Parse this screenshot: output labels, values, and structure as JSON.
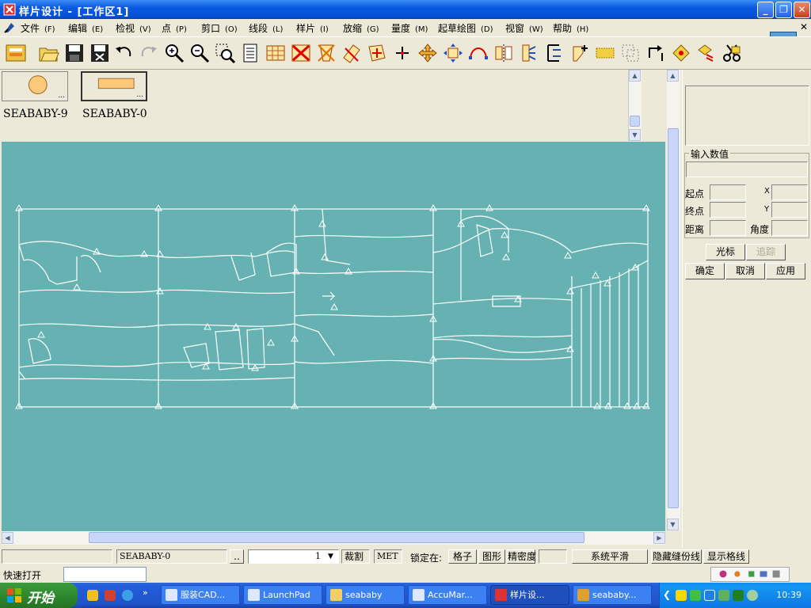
{
  "window": {
    "title": "样片设计 - [工作区1]"
  },
  "menu": [
    {
      "label": "文件",
      "key": "(F)"
    },
    {
      "label": "编辑",
      "key": "(E)"
    },
    {
      "label": "检视",
      "key": "(V)"
    },
    {
      "label": "点",
      "key": "(P)"
    },
    {
      "label": "剪口",
      "key": "(O)"
    },
    {
      "label": "线段",
      "key": "(L)"
    },
    {
      "label": "样片",
      "key": "(I)"
    },
    {
      "label": "放缩",
      "key": "(G)"
    },
    {
      "label": "量度",
      "key": "(M)"
    },
    {
      "label": "起草绘图",
      "key": "(D)"
    },
    {
      "label": "视窗",
      "key": "(W)"
    },
    {
      "label": "帮助",
      "key": "(H)"
    }
  ],
  "pieces": [
    {
      "label": "SEABABY-9",
      "shape": "circle"
    },
    {
      "label": "SEABABY-0",
      "shape": "rect"
    }
  ],
  "right_panel": {
    "input_group": "输入数值",
    "start": "起点",
    "end": "终点",
    "distance": "距离",
    "x": "X",
    "y": "Y",
    "angle": "角度",
    "cursor_btn": "光标",
    "trace_btn": "追踪",
    "ok_btn": "确定",
    "cancel_btn": "取消",
    "apply_btn": "应用"
  },
  "status": {
    "piece_name": "SEABABY-0",
    "browse": "..",
    "combo_value": "1",
    "cut": "裁割",
    "unit": "MET",
    "lock_label": "锁定在:",
    "grid": "格子",
    "shape": "图形",
    "density": "精密度",
    "smooth": "系统平滑",
    "hide_seam": "隐藏缝份线",
    "show_grid": "显示格线"
  },
  "quick_open": "快速打开",
  "taskbar": {
    "start": "开始",
    "tasks": [
      {
        "label": "服装CAD..."
      },
      {
        "label": "LaunchPad"
      },
      {
        "label": "seababy"
      },
      {
        "label": "AccuMar..."
      },
      {
        "label": "样片设..."
      },
      {
        "label": "seababy..."
      }
    ],
    "clock": "10:39"
  },
  "colors": {
    "canvas": "#66b2b2",
    "taskbar": "#245edb",
    "start": "#2f8a2f",
    "marker_lines": "#ffffff"
  }
}
